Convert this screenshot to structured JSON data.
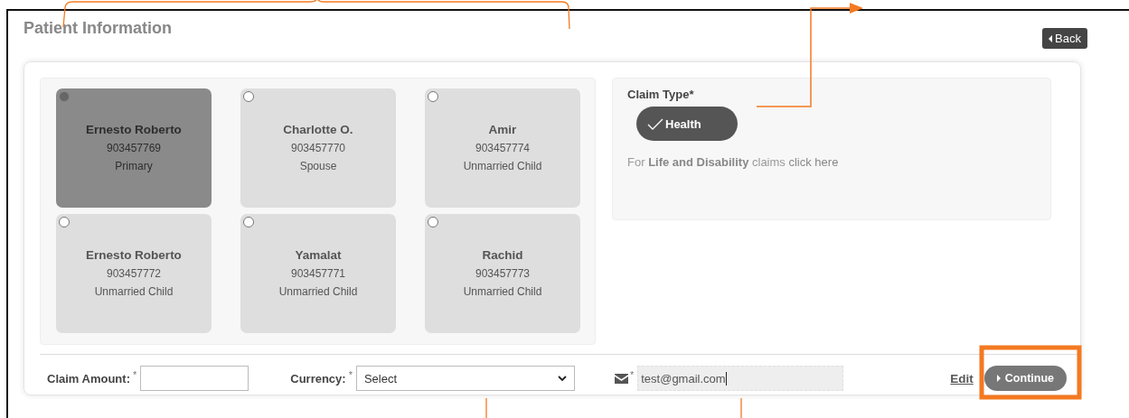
{
  "page": {
    "title": "Patient Information",
    "back_button": "Back"
  },
  "members": [
    {
      "name": "Ernesto Roberto",
      "id": "903457769",
      "relation": "Primary",
      "selected": true
    },
    {
      "name": "Charlotte O.",
      "id": "903457770",
      "relation": "Spouse",
      "selected": false
    },
    {
      "name": "Amir",
      "id": "903457774",
      "relation": "Unmarried Child",
      "selected": false
    },
    {
      "name": "Ernesto Roberto",
      "id": "903457772",
      "relation": "Unmarried Child",
      "selected": false
    },
    {
      "name": "Yamalat",
      "id": "903457771",
      "relation": "Unmarried Child",
      "selected": false
    },
    {
      "name": "Rachid",
      "id": "903457773",
      "relation": "Unmarried Child",
      "selected": false
    }
  ],
  "claim_type": {
    "label": "Claim Type*",
    "options": [
      {
        "label": "Health",
        "selected": true
      }
    ],
    "note": "For **Life and Disability** claims",
    "link": "click here"
  },
  "form": {
    "claim_amount_label": "Claim Amount:",
    "required_mark": "*",
    "currency_label": "Currency:",
    "currency_placeholder": "Select",
    "email_value": "test@gmail.com",
    "edit_link": "Edit",
    "continue_button": "Continue"
  },
  "annotations": [
    {
      "kind": "bracket"
    },
    {
      "kind": "arrow"
    },
    {
      "kind": "line"
    },
    {
      "kind": "line"
    },
    {
      "kind": "frame"
    }
  ]
}
